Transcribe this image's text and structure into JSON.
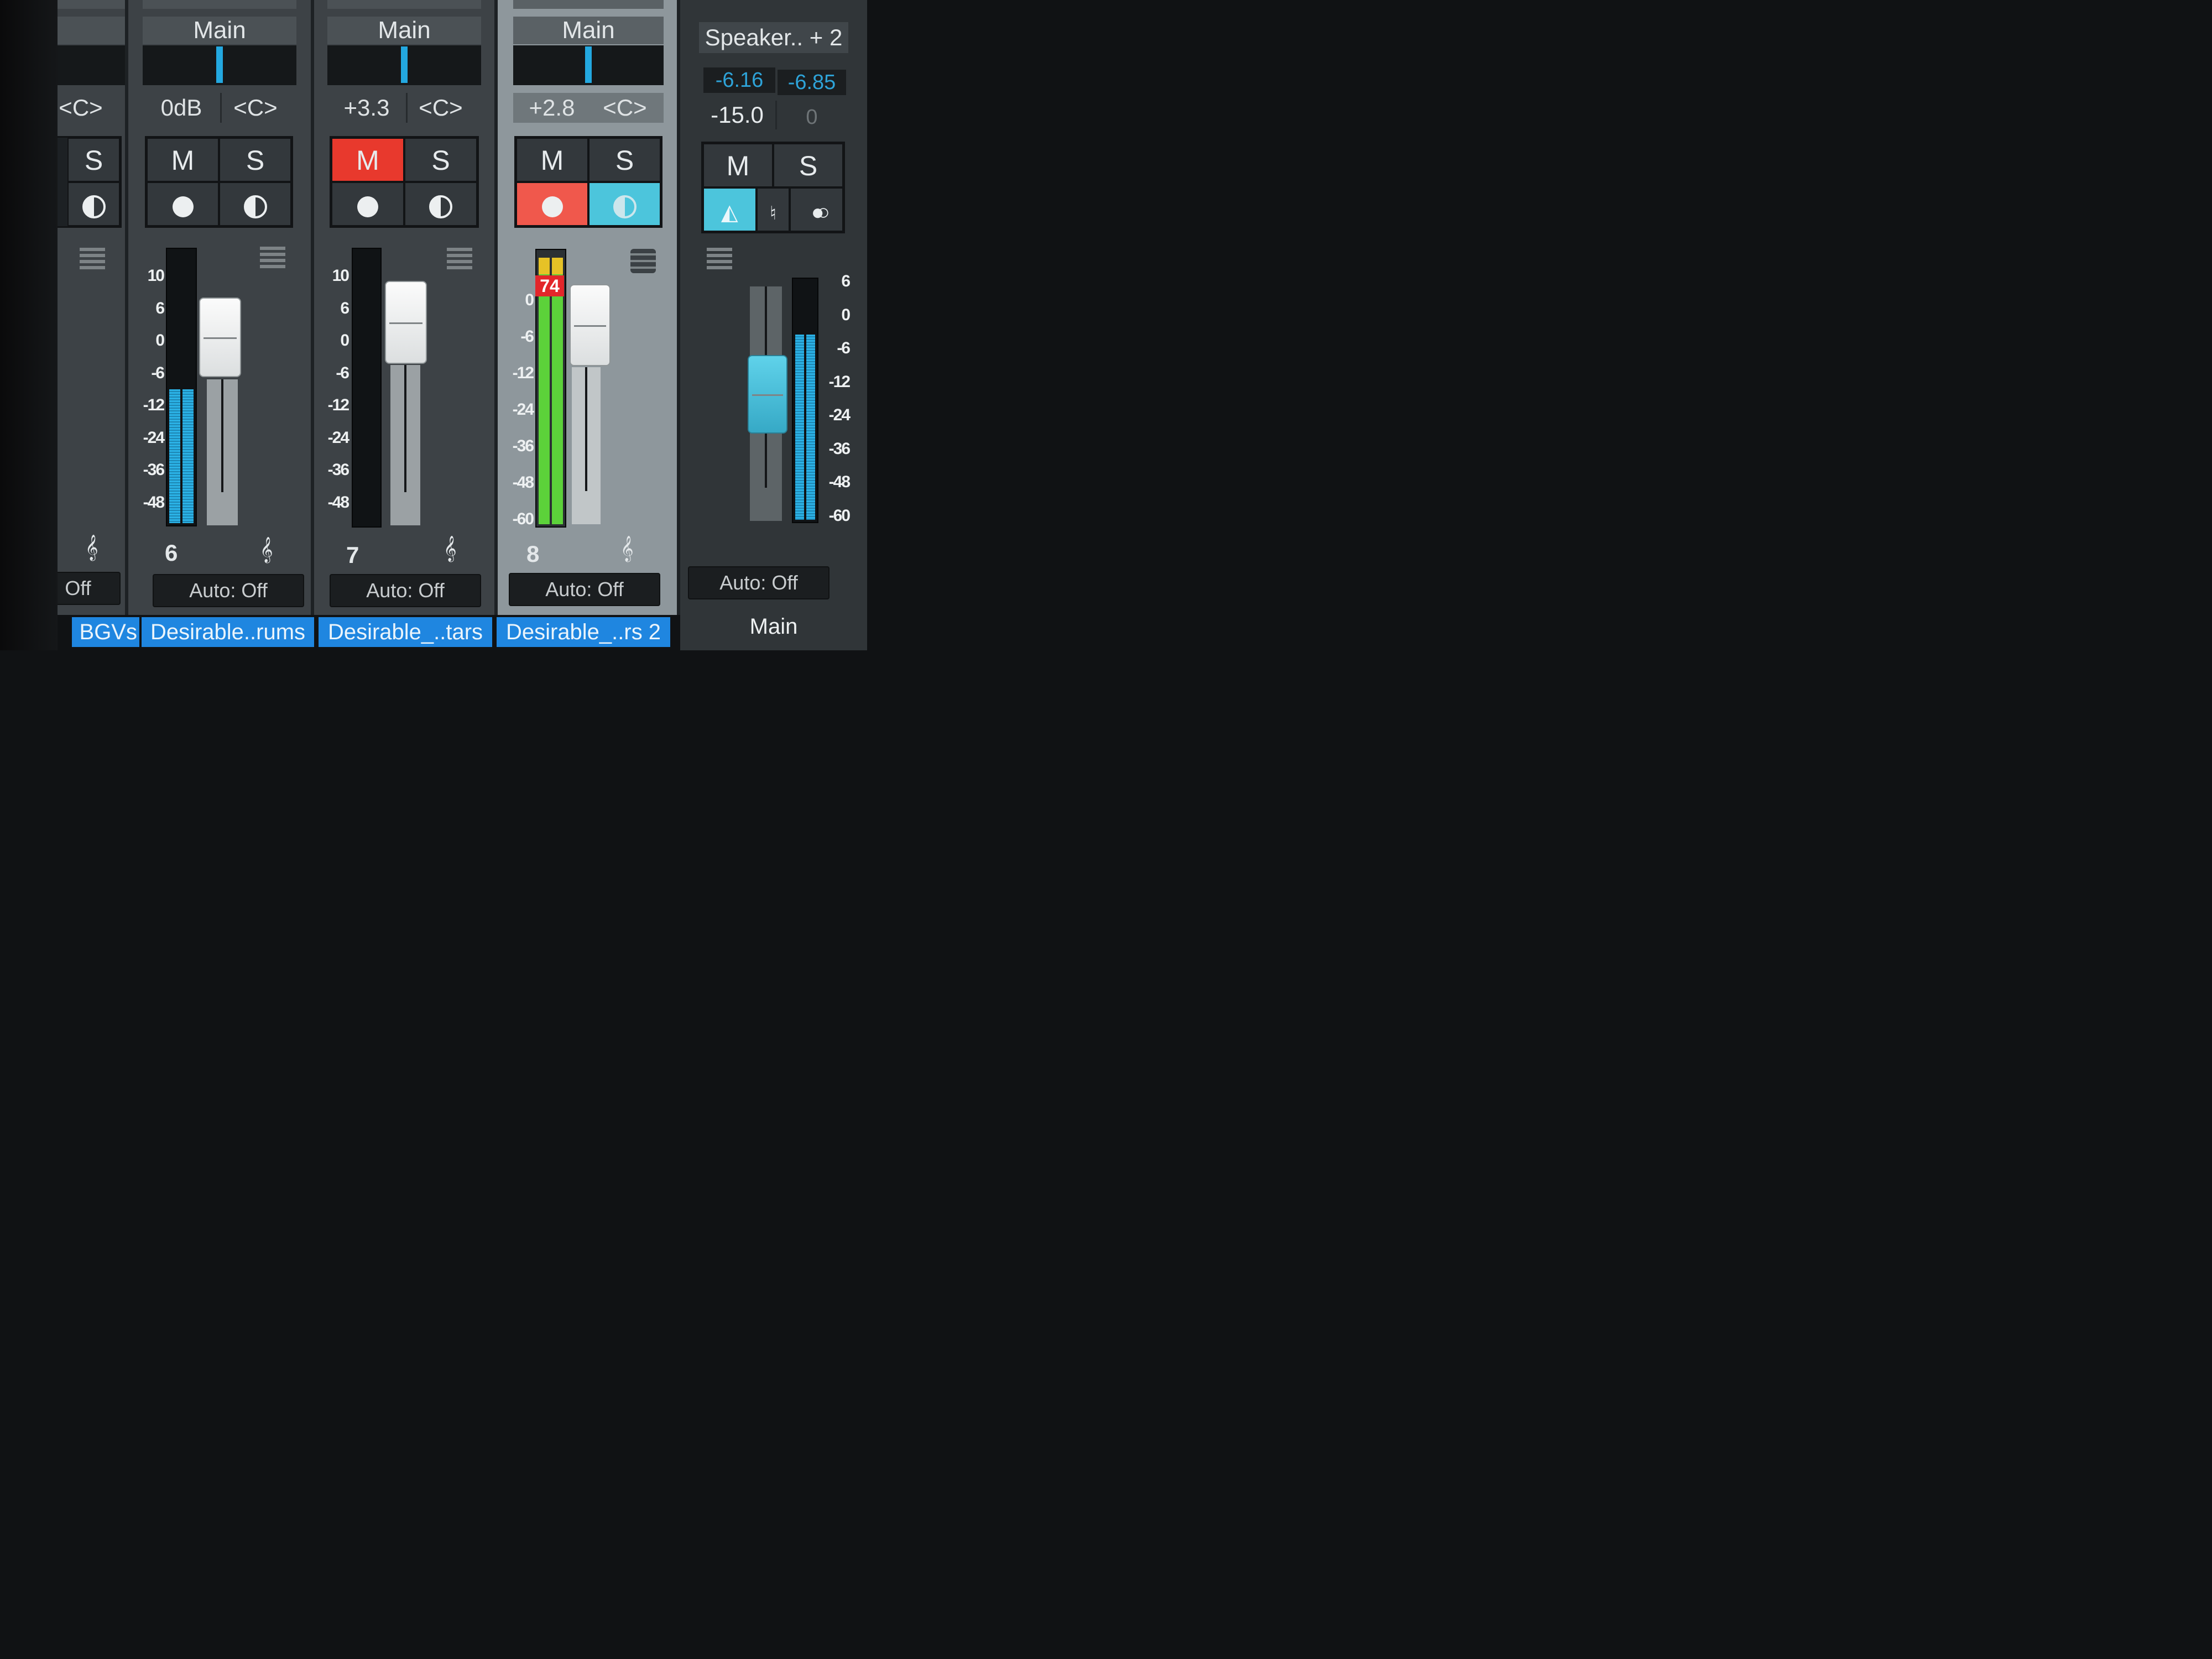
{
  "strip5": {
    "pan": "<C>",
    "solo_label": "S",
    "automation": "Off",
    "name": "BGVs"
  },
  "strip6": {
    "route": "Main",
    "volume": "0dB",
    "pan": "<C>",
    "mute_label": "M",
    "solo_label": "S",
    "number": "6",
    "automation": "Auto: Off",
    "name": "Desirable..rums",
    "meter_level": 0.5
  },
  "strip7": {
    "route": "Main",
    "volume": "+3.3",
    "pan": "<C>",
    "mute_label": "M",
    "solo_label": "S",
    "number": "7",
    "automation": "Auto: Off",
    "name": "Desirable_..tars",
    "muted": true,
    "meter_level": 0.0
  },
  "strip8": {
    "route": "Main",
    "volume": "+2.8",
    "pan": "<C>",
    "mute_label": "M",
    "solo_label": "S",
    "number": "8",
    "automation": "Auto: Off",
    "name": "Desirable_..rs 2",
    "clip_value": "74",
    "record_armed": true,
    "monitor_on": true,
    "meter_level": 0.98
  },
  "master": {
    "output": "Speaker.. + 2",
    "peak_left": "-6.16",
    "peak_right": "-6.85",
    "volume": "-15.0",
    "pan": "0",
    "mute_label": "M",
    "solo_label": "S",
    "automation": "Auto: Off",
    "name": "Main",
    "meter_level": 0.78
  },
  "scales": {
    "strip": [
      "10",
      "6",
      "0",
      "-6",
      "-12",
      "-24",
      "-36",
      "-48"
    ],
    "strip8": [
      "0",
      "-6",
      "-12",
      "-24",
      "-36",
      "-48",
      "-60"
    ],
    "master": [
      "6",
      "0",
      "-6",
      "-12",
      "-24",
      "-36",
      "-48",
      "-60"
    ]
  },
  "colors": {
    "accent_blue": "#1f86e0",
    "mute_red": "#e8392d",
    "record_red": "#f0584c",
    "monitor_cyan": "#4cc5dc",
    "meter_cyan": "#2bb2e6",
    "meter_green": "#5cd23a"
  }
}
